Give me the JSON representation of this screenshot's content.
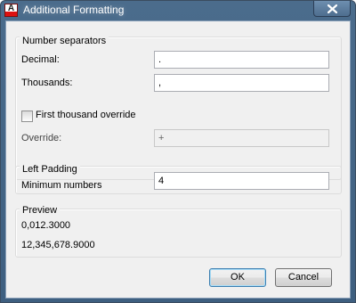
{
  "window": {
    "title": "Additional Formatting",
    "app_icon_letter": "A"
  },
  "number_separators": {
    "title": "Number separators",
    "decimal_label": "Decimal:",
    "decimal_value": ".",
    "thousands_label": "Thousands:",
    "thousands_value": ",",
    "override_checkbox_label": "First thousand override",
    "override_checked": false,
    "override_label": "Override:",
    "override_value": "+"
  },
  "left_padding": {
    "title": "Left Padding",
    "min_numbers_label": "Minimum numbers",
    "min_numbers_value": "4"
  },
  "preview": {
    "title": "Preview",
    "line1": "0,012.3000",
    "line2": "12,345,678.9000"
  },
  "buttons": {
    "ok": "OK",
    "cancel": "Cancel"
  },
  "colors": {
    "titlebar": "#4b6c8c",
    "dialog_bg": "#f0f0f0",
    "default_button_border": "#3c7fb1"
  }
}
